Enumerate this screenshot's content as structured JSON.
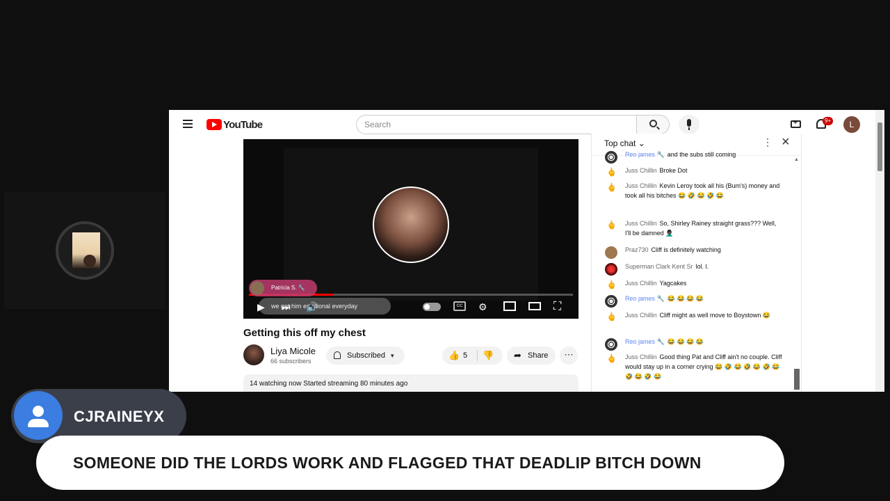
{
  "youtube": {
    "logo_text": "YouTube",
    "search_placeholder": "Search",
    "notification_badge": "9+",
    "account_initial": "L"
  },
  "video": {
    "superchat_name": "Patricia S. 🔧",
    "superchat_message": "we got him emotional everyday",
    "title": "Getting this off my chest",
    "channel_name": "Liya Micole",
    "channel_subscribers": "66 subscribers",
    "subscribe_label": "Subscribed",
    "like_count": "5",
    "share_label": "Share",
    "description_line": "14 watching now  Started streaming 80 minutes ago"
  },
  "chat": {
    "header_title": "Top chat",
    "messages": [
      {
        "author": "Reo james 🔧",
        "text": "and the subs still coming",
        "avatar": "reo"
      },
      {
        "author": "Juss Chillin",
        "text": "Broke Dot",
        "avatar": "finger"
      },
      {
        "author": "Juss Chillin",
        "text": "Kevin Leroy took all his (Bum's) money and took all his bitches 😂 🤣 😂 🤣 😂",
        "avatar": "finger"
      },
      {
        "author": "Juss Chillin",
        "text": "So, Shirley Rainey straight grass??? Well, I'll be damned 🤦🏿‍♂️",
        "avatar": "finger"
      },
      {
        "author": "Praz730",
        "text": "Cliff is definitely watching",
        "avatar": "praz"
      },
      {
        "author": "Superman Clark Kent Sr",
        "text": "lol. l.",
        "avatar": "superman"
      },
      {
        "author": "Juss Chillin",
        "text": "Yagcakes",
        "avatar": "finger"
      },
      {
        "author": "Reo james 🔧",
        "text": "😂 😂 😂 😂",
        "avatar": "reo"
      },
      {
        "author": "Juss Chillin",
        "text": "Cliff might as well move to Boystown 😂",
        "avatar": "finger"
      },
      {
        "author": "Reo james 🔧",
        "text": "😂 😂 😂 😂",
        "avatar": "reo"
      },
      {
        "author": "Juss Chillin",
        "text": "Good thing Pat and Cliff ain't no couple. Cliff would stay up in a corner crying 😂 🤣 😂 🤣 😂 🤣 😂 🤣 😂 🤣 😂",
        "avatar": "finger"
      }
    ]
  },
  "overlay": {
    "username": "CJRAINEYX",
    "comment": "SOMEONE DID THE LORDS WORK AND FLAGGED THAT DEADLIP BITCH DOWN"
  },
  "colors": {
    "youtube_red": "#ff0000",
    "moderator_blue": "#5e84f1",
    "user_badge_blue": "#3b7de0"
  }
}
